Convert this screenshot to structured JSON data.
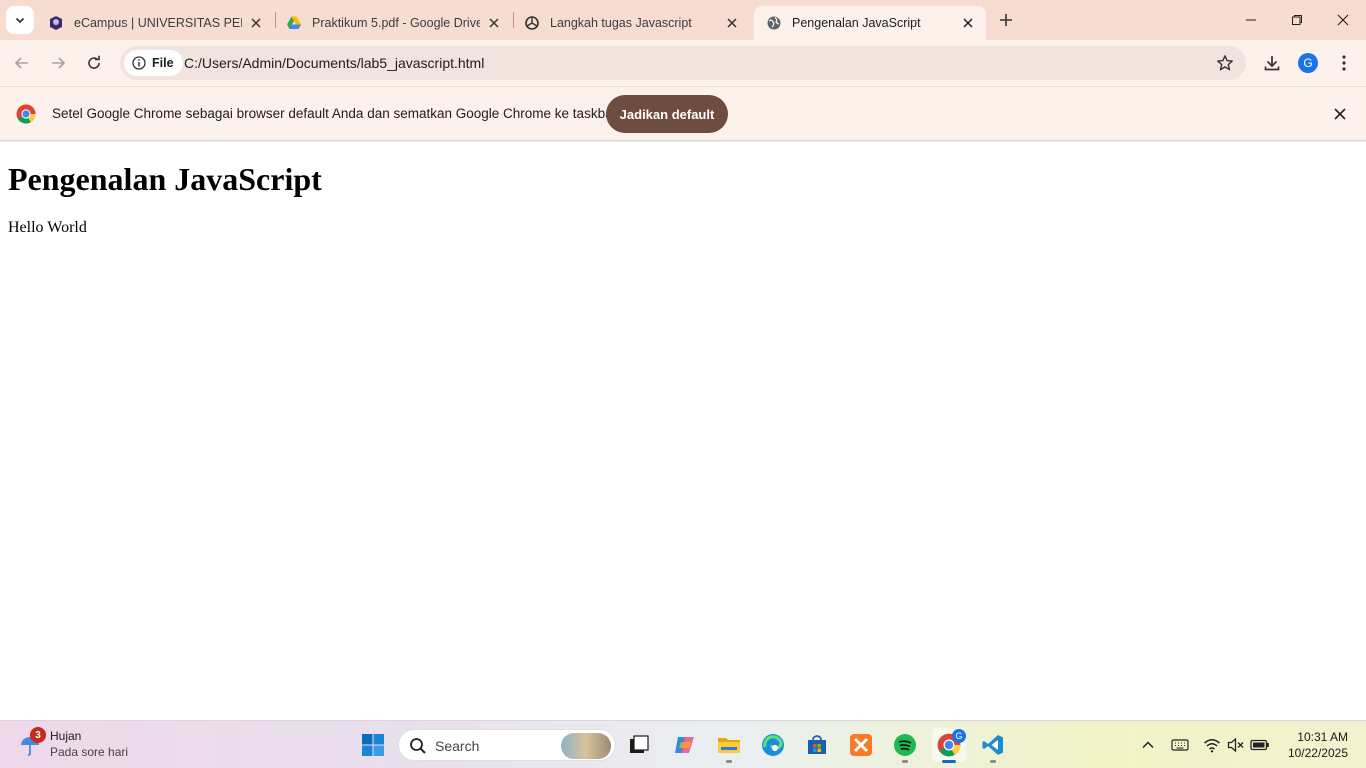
{
  "browser": {
    "tabs": [
      {
        "title": "eCampus | UNIVERSITAS PELITA",
        "favicon": "ecampus-icon",
        "active": false
      },
      {
        "title": "Praktikum 5.pdf - Google Drive",
        "favicon": "google-drive-icon",
        "active": false
      },
      {
        "title": "Langkah tugas Javascript",
        "favicon": "chatgpt-icon",
        "active": false
      },
      {
        "title": "Pengenalan JavaScript",
        "favicon": "globe-icon",
        "active": true
      }
    ],
    "address": {
      "chip_label": "File",
      "url": "C:/Users/Admin/Documents/lab5_javascript.html"
    },
    "profile_initial": "G",
    "infobar": {
      "message": "Setel Google Chrome sebagai browser default Anda dan sematkan Google Chrome ke taskbar",
      "button_label": "Jadikan default"
    }
  },
  "page": {
    "heading": "Pengenalan JavaScript",
    "paragraph": "Hello World"
  },
  "taskbar": {
    "weather": {
      "badge": "3",
      "title": "Hujan",
      "subtitle": "Pada sore hari"
    },
    "search_placeholder": "Search",
    "chrome_badge": "G",
    "clock": {
      "time": "10:31 AM",
      "date": "10/22/2025"
    }
  },
  "colors": {
    "tabstrip": "#f7dcd2",
    "toolbar": "#fdf1ec",
    "accent_button": "#6e4c40",
    "profile": "#1a73e8"
  }
}
